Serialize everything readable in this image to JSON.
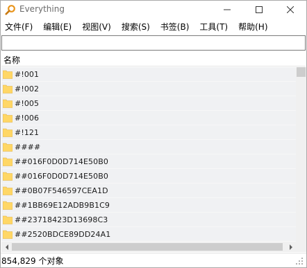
{
  "window": {
    "title": "Everything",
    "icon": "magnifier-icon",
    "accent_color": "#f0a020"
  },
  "menu": {
    "items": [
      "文件(F)",
      "编辑(E)",
      "视图(V)",
      "搜索(S)",
      "书签(B)",
      "工具(T)",
      "帮助(H)"
    ]
  },
  "search": {
    "value": "",
    "placeholder": ""
  },
  "list": {
    "columns": [
      "名称"
    ],
    "rows": [
      "#!001",
      "#!002",
      "#!005",
      "#!006",
      "#!121",
      "####",
      "##016F0D0D714E50B0",
      "##016F0D0D714E50B0",
      "##0B07F546597CEA1D",
      "##1BB69E12ADB9B1C9",
      "##23718423D13698C3",
      "##2520BDCE89DD24A1"
    ],
    "row_icon": "folder-icon",
    "folder_color": "#ffd766"
  },
  "status": {
    "text": "854,829 个对象"
  }
}
